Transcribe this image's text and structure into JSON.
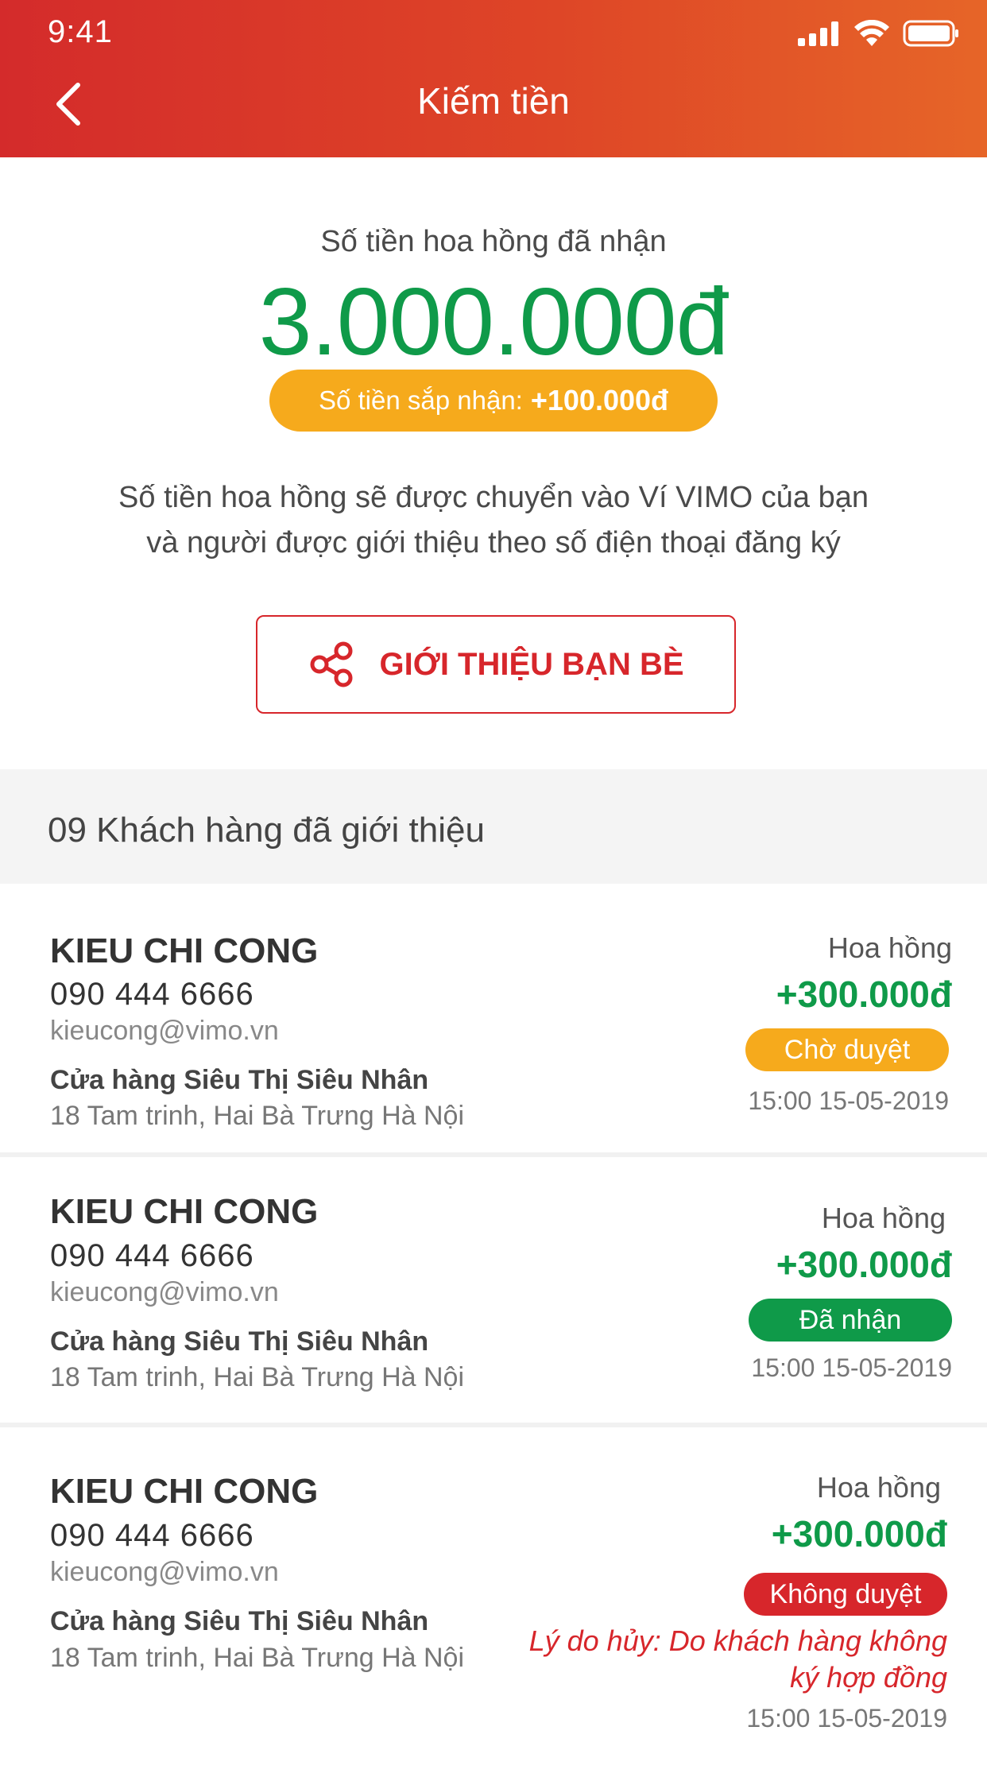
{
  "status_bar": {
    "time": "9:41"
  },
  "header": {
    "title": "Kiếm tiền"
  },
  "summary": {
    "label": "Số tiền hoa hồng đã nhận",
    "amount": "3.000.000đ",
    "pending_label": "Số tiền sắp nhận:",
    "pending_value": "+100.000đ",
    "description_line1": "Số tiền hoa hồng sẽ được chuyển vào Ví VIMO của bạn",
    "description_line2": "và người được giới thiệu theo số điện thoại đăng ký",
    "invite_button": "GIỚI THIỆU BẠN BÈ"
  },
  "section": {
    "title": "09 Khách hàng đã giới thiệu"
  },
  "customers": [
    {
      "name": "KIEU CHI CONG",
      "phone": "090 444 6666",
      "email": "kieucong@vimo.vn",
      "store": "Cửa hàng Siêu Thị Siêu Nhân",
      "address": "18 Tam trinh, Hai Bà Trưng Hà Nội",
      "commission_label": "Hoa hồng",
      "commission": "+300.000đ",
      "status": "Chờ duyệt",
      "time": "15:00 15-05-2019"
    },
    {
      "name": "KIEU CHI CONG",
      "phone": "090 444 6666",
      "email": "kieucong@vimo.vn",
      "store": "Cửa hàng Siêu Thị Siêu Nhân",
      "address": "18 Tam trinh, Hai Bà Trưng Hà Nội",
      "commission_label": "Hoa hồng",
      "commission": "+300.000đ",
      "status": "Đã nhận",
      "time": "15:00 15-05-2019"
    },
    {
      "name": "KIEU CHI CONG",
      "phone": "090 444 6666",
      "email": "kieucong@vimo.vn",
      "store": "Cửa hàng Siêu Thị Siêu Nhân",
      "address": "18 Tam trinh, Hai Bà Trưng Hà Nội",
      "commission_label": "Hoa hồng",
      "commission": "+300.000đ",
      "status": "Không duyệt",
      "reason_line1": "Lý do hủy: Do khách hàng không",
      "reason_line2": "ký hợp đồng",
      "time": "15:00 15-05-2019"
    }
  ],
  "colors": {
    "header_start": "#d42b2b",
    "header_end": "#e66528",
    "amount_green": "#0f9a49",
    "pending_orange": "#f6aa1c",
    "brand_red": "#d7262b",
    "status_received": "#0f9a49",
    "status_rejected": "#d7262b"
  },
  "icons": {
    "back": "chevron-left-icon",
    "share": "share-icon",
    "signal": "signal-icon",
    "wifi": "wifi-icon",
    "battery": "battery-icon"
  }
}
